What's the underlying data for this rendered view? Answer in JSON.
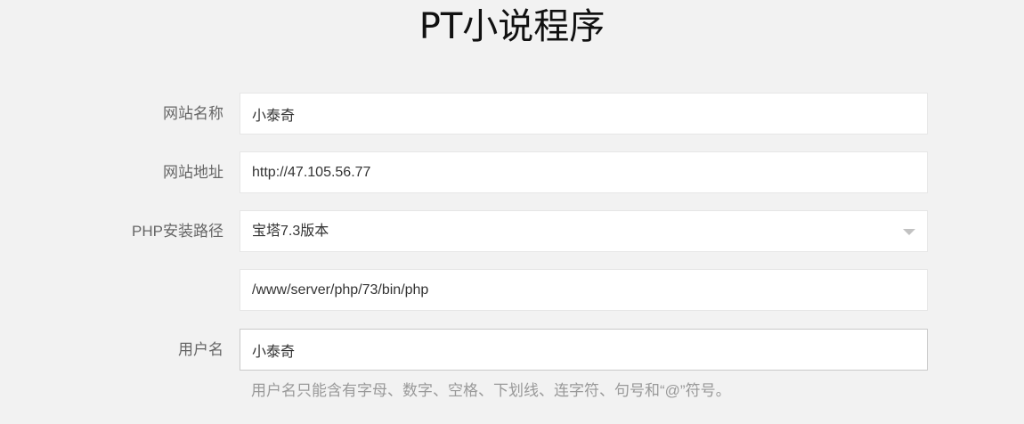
{
  "header": {
    "title": "PT小说程序"
  },
  "form": {
    "site_name": {
      "label": "网站名称",
      "value": "小泰奇"
    },
    "site_url": {
      "label": "网站地址",
      "value": "http://47.105.56.77"
    },
    "php_path": {
      "label": "PHP安装路径",
      "selected": "宝塔7.3版本",
      "path_value": "/www/server/php/73/bin/php"
    },
    "username": {
      "label": "用户名",
      "value": "小泰奇",
      "hint": "用户名只能含有字母、数字、空格、下划线、连字符、句号和“@”符号。"
    }
  },
  "icons": {
    "select_caret": "chevron-down-icon"
  }
}
